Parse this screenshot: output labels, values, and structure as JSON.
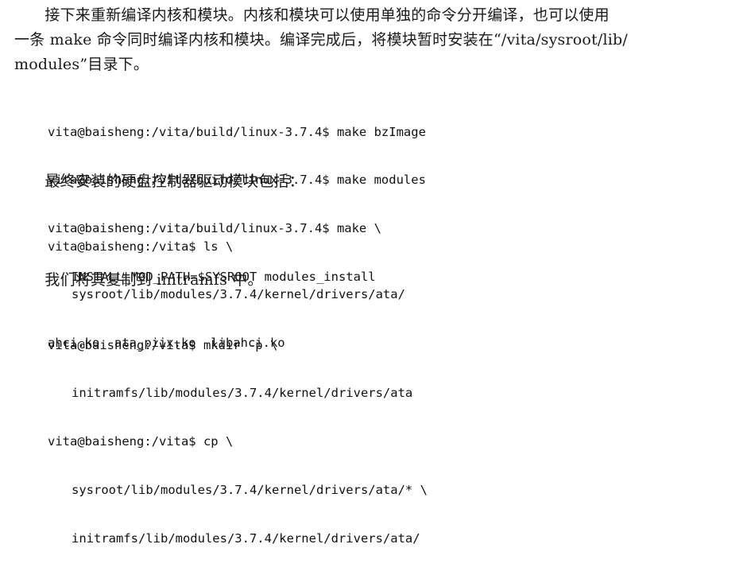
{
  "intro_paragraph": {
    "lines": [
      "　　接下来重新编译内核和模块。内核和模块可以使用单独的命令分开编译，也可以使用",
      "一条 make 命令同时编译内核和模块。编译完成后，将模块暂时安装在“/vita/sysroot/lib/",
      "modules”目录下。"
    ]
  },
  "code_block_build": [
    "vita@baisheng:/vita/build/linux-3.7.4$ make bzImage",
    "vita@baisheng:/vita/build/linux-3.7.4$ make modules",
    "vita@baisheng:/vita/build/linux-3.7.4$ make \\",
    "INSTALL_MOD_PATH=$SYSROOT modules_install"
  ],
  "paragraph_driver_modules": "　　最终安装的硬盘控制器驱动模块包括：",
  "code_block_ls": [
    "vita@baisheng:/vita$ ls \\",
    "sysroot/lib/modules/3.7.4/kernel/drivers/ata/",
    "ahci.ko  ata_piix.ko  libahci.ko"
  ],
  "paragraph_copy": "　　我们将其复制到 initramfs 中。",
  "code_block_copy": [
    "vita@baisheng:/vita$ mkdir -p \\",
    "initramfs/lib/modules/3.7.4/kernel/drivers/ata",
    "vita@baisheng:/vita$ cp \\",
    "sysroot/lib/modules/3.7.4/kernel/drivers/ata/* \\",
    "initramfs/lib/modules/3.7.4/kernel/drivers/ata/"
  ]
}
